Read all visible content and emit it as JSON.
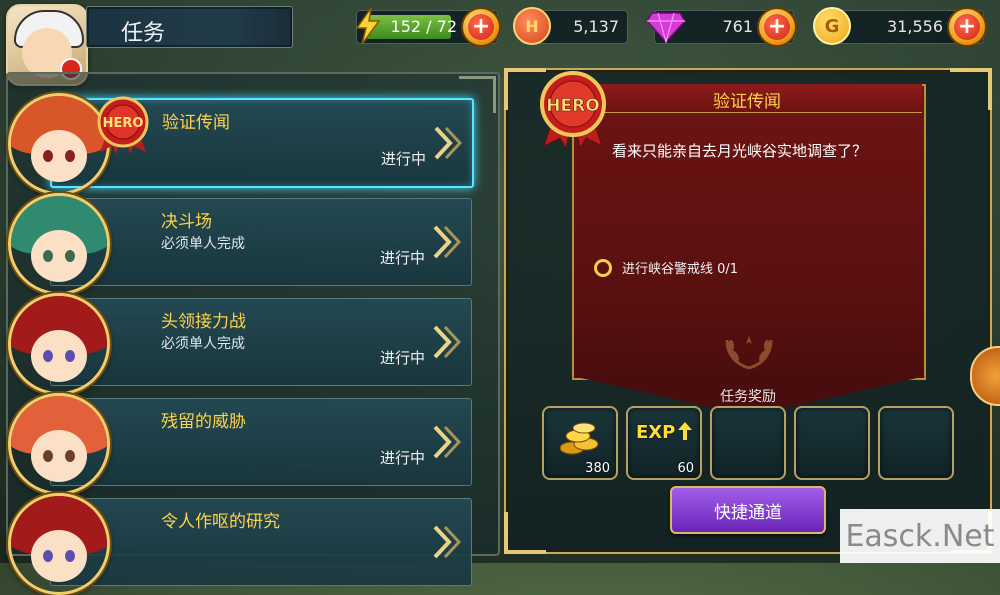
{
  "header": {
    "title": "任务"
  },
  "resources": {
    "energy": {
      "icon": "lightning-icon",
      "value": "152 / 72",
      "fill_fraction": 1.0
    },
    "honor": {
      "icon": "honor-coin-icon",
      "icon_letter": "H",
      "value": "5,137"
    },
    "gems": {
      "icon": "gem-icon",
      "value": "761"
    },
    "gold": {
      "icon": "gold-coin-icon",
      "icon_letter": "G",
      "value": "31,556"
    },
    "plus_label": "+"
  },
  "quests": [
    {
      "name": "验证传闻",
      "subtitle": "",
      "status": "进行中",
      "selected": true,
      "hair": "#d9552a",
      "eye": "#8a1f1f"
    },
    {
      "name": "决斗场",
      "subtitle": "必须单人完成",
      "status": "进行中",
      "selected": false,
      "hair": "#2f8a6f",
      "eye": "#3b6b4e"
    },
    {
      "name": "头领接力战",
      "subtitle": "必须单人完成",
      "status": "进行中",
      "selected": false,
      "hair": "#a31a1a",
      "eye": "#5a4fb0"
    },
    {
      "name": "残留的威胁",
      "subtitle": "",
      "status": "进行中",
      "selected": false,
      "hair": "#e2603a",
      "eye": "#6b3f2a"
    },
    {
      "name": "令人作呕的研究",
      "subtitle": "",
      "status": "",
      "selected": false,
      "hair": "#a31a1a",
      "eye": "#5a4fb0"
    }
  ],
  "badge_text": "HERO",
  "detail": {
    "title": "验证传闻",
    "story": "看来只能亲自去月光峡谷实地调查了？",
    "objective": "进行峡谷警戒线 0/1",
    "reward_title": "任务奖励",
    "rewards": [
      {
        "type": "gold",
        "icon": "gold-coins-icon",
        "count": "380"
      },
      {
        "type": "exp",
        "icon": "exp-up-icon",
        "label": "EXP",
        "count": "60"
      },
      {
        "type": "empty",
        "count": ""
      },
      {
        "type": "empty",
        "count": ""
      },
      {
        "type": "empty",
        "count": ""
      }
    ],
    "quick_button": "快捷通道"
  },
  "watermark": "Easck.Net",
  "colors": {
    "accent_yellow": "#ffd24a",
    "selected_glow": "#57e6ff",
    "scroll_red": "#6e1414",
    "button_purple": "#8a3fd6"
  }
}
